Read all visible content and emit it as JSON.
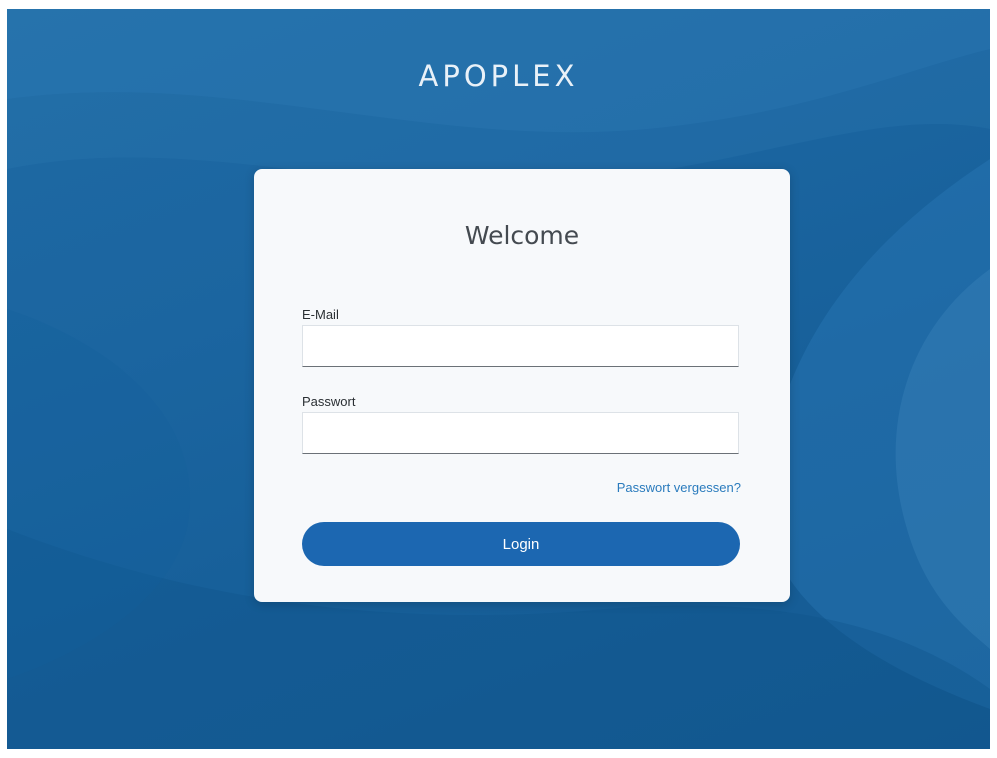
{
  "brand": {
    "name": "APOPLEX"
  },
  "login_card": {
    "heading": "Welcome",
    "email": {
      "label": "E-Mail",
      "value": "",
      "placeholder": ""
    },
    "password": {
      "label": "Passwort",
      "value": "",
      "placeholder": ""
    },
    "forgot_link": "Passwort vergessen?",
    "login_button": "Login"
  },
  "colors": {
    "background": "#1b65a0",
    "card": "#f7f9fb",
    "button": "#1c67b1",
    "link": "#2a7bbd"
  }
}
